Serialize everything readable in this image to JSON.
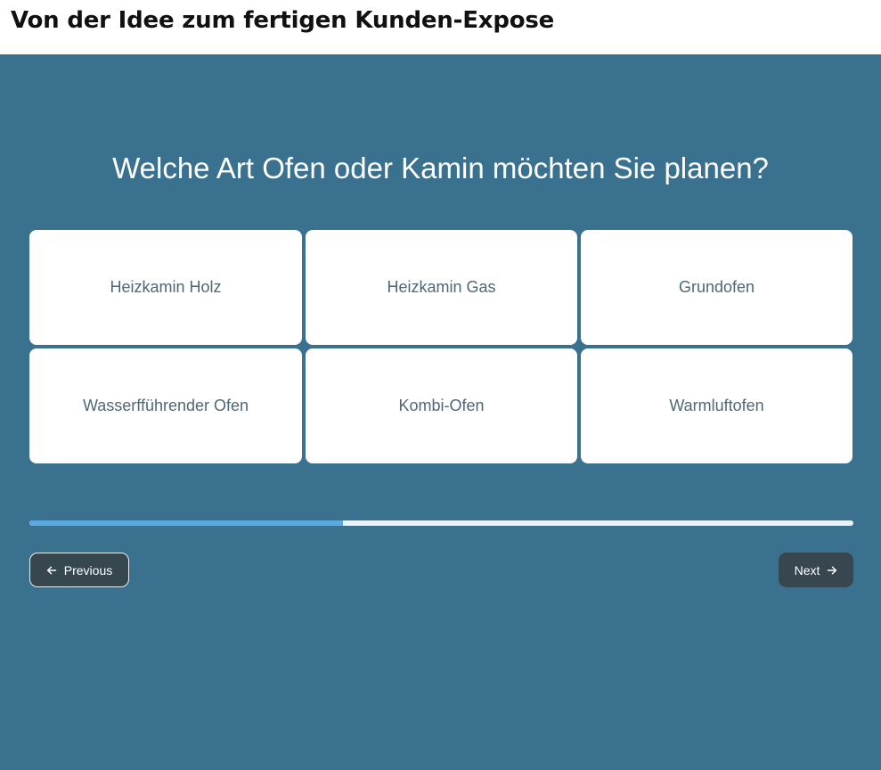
{
  "header": {
    "title": "Von der Idee zum fertigen Kunden-Expose"
  },
  "question": "Welche Art Ofen oder Kamin möchten Sie planen?",
  "options": [
    {
      "label": "Heizkamin Holz"
    },
    {
      "label": "Heizkamin Gas"
    },
    {
      "label": "Grundofen"
    },
    {
      "label": "Wasserfführender Ofen"
    },
    {
      "label": "Kombi-Ofen"
    },
    {
      "label": "Warmluftofen"
    }
  ],
  "progress": {
    "fraction": 0.38
  },
  "nav": {
    "previous_label": "Previous",
    "previous_icon": "arrow-left-icon",
    "next_label": "Next",
    "next_icon": "arrow-right-icon"
  },
  "colors": {
    "background": "#3a718e",
    "card": "#ffffff",
    "progress_fill": "#5aa9e0",
    "progress_track": "#e8f2f8",
    "button": "#37474f"
  }
}
